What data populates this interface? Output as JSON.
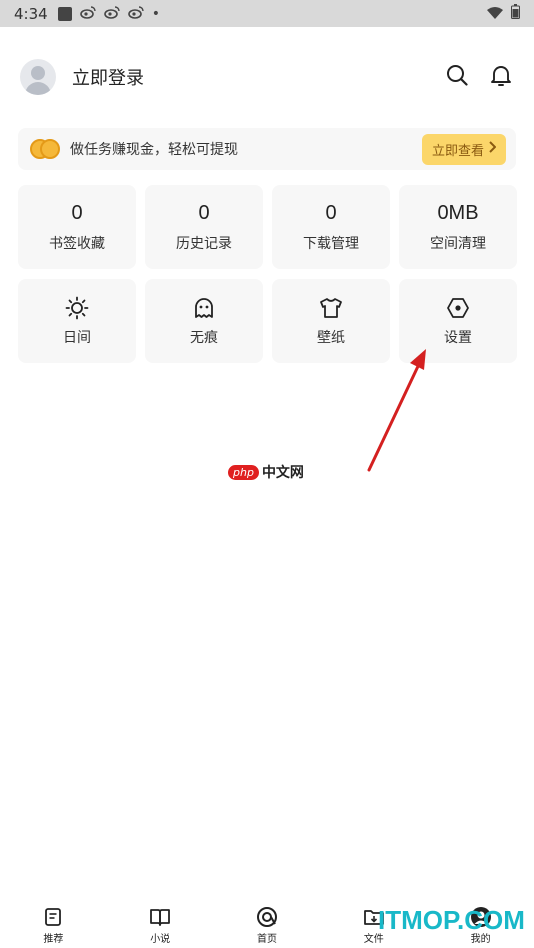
{
  "status_bar": {
    "time": "4:34",
    "weibo_icon_text": "微",
    "dot": "•"
  },
  "profile": {
    "login_label": "立即登录"
  },
  "banner": {
    "text": "做任务赚现金，轻松可提现",
    "cta_label": "立即查看"
  },
  "stats": [
    {
      "value": "0",
      "label": "书签收藏"
    },
    {
      "value": "0",
      "label": "历史记录"
    },
    {
      "value": "0",
      "label": "下载管理"
    },
    {
      "value": "0MB",
      "label": "空间清理"
    }
  ],
  "tools": [
    {
      "icon": "sun-icon",
      "label": "日间"
    },
    {
      "icon": "ghost-icon",
      "label": "无痕"
    },
    {
      "icon": "shirt-icon",
      "label": "壁纸"
    },
    {
      "icon": "hexagon-settings-icon",
      "label": "设置"
    }
  ],
  "watermark": {
    "php": "php",
    "cn": "中文网"
  },
  "tabs": [
    {
      "icon": "document-icon",
      "label": "推荐"
    },
    {
      "icon": "book-icon",
      "label": "小说"
    },
    {
      "icon": "home-icon",
      "label": "首页"
    },
    {
      "icon": "folder-icon",
      "label": "文件"
    },
    {
      "icon": "avatar-icon",
      "label": "我的"
    }
  ],
  "site_watermark": "ITMOP.COM",
  "colors": {
    "accent_button": "#fbd66a",
    "arrow": "#d42020",
    "watermark_cyan": "#19b8c8"
  }
}
